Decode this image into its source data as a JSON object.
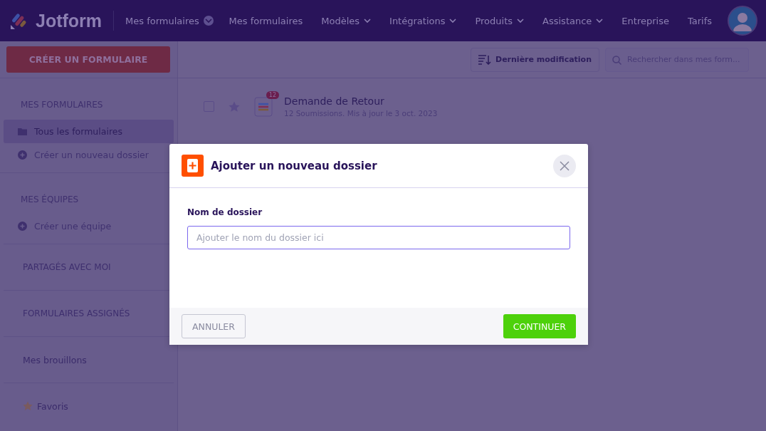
{
  "header": {
    "brand": "Jotform",
    "workspace": "Mes formulaires",
    "nav": [
      {
        "label": "Mes formulaires",
        "dropdown": false
      },
      {
        "label": "Modèles",
        "dropdown": true
      },
      {
        "label": "Intégrations",
        "dropdown": true
      },
      {
        "label": "Produits",
        "dropdown": true
      },
      {
        "label": "Assistance",
        "dropdown": true
      },
      {
        "label": "Entreprise",
        "dropdown": false
      },
      {
        "label": "Tarifs",
        "dropdown": false
      }
    ]
  },
  "sidebar": {
    "create_button": "CRÉER UN FORMULAIRE",
    "sections": [
      {
        "heading": "MES FORMULAIRES",
        "items": [
          {
            "label": "Tous les formulaires",
            "kind": "folder",
            "selected": true
          },
          {
            "label": "Créer un nouveau dossier",
            "kind": "add",
            "selected": false
          }
        ]
      },
      {
        "heading": "MES ÉQUIPES",
        "items": [
          {
            "label": "Créer une équipe",
            "kind": "add",
            "selected": false
          }
        ]
      }
    ],
    "links": [
      {
        "label": "PARTAGÉS AVEC MOI",
        "kind": "heading"
      },
      {
        "label": "FORMULAIRES ASSIGNÉS",
        "kind": "heading"
      },
      {
        "label": "Mes brouillons",
        "kind": "plain"
      },
      {
        "label": "Favoris",
        "kind": "favorite"
      }
    ]
  },
  "toolbar": {
    "sort": "Dernière modification",
    "search": {
      "placeholder": "Rechercher dans mes form..."
    }
  },
  "forms": [
    {
      "title": "Demande de Retour",
      "meta": "12 Soumissions. Mis à jour le 3 oct. 2023",
      "badge": "12",
      "checked": false,
      "starred": false
    }
  ],
  "dialog": {
    "title": "Ajouter un nouveau dossier",
    "field_label": "Nom de dossier",
    "field": {
      "placeholder": "Ajouter le nom du dossier ici"
    },
    "buttons": [
      {
        "label": "ANNULER",
        "kind": "secondary"
      },
      {
        "label": "CONTINUER",
        "kind": "primary"
      }
    ]
  }
}
